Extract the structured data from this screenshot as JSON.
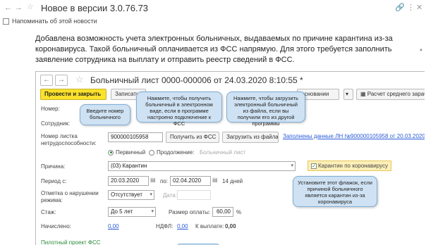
{
  "window": {
    "title": "Новое в версии 3.0.76.73",
    "controls": {
      "link": "🔗",
      "more": "⋮",
      "close": "✕"
    }
  },
  "remind": {
    "label": "Напоминать об этой новости",
    "checked": false
  },
  "intro": {
    "text": "Добавлена возможность учета электронных больничных, выдаваемых по причине карантина из-за коронавируса. Такой больничный оплачивается из ФСС напрямую. Для этого требуется заполнить заявление сотрудника на выплату и отправить реестр сведений в ФСС."
  },
  "form": {
    "title": "Больничный лист 0000-000006 от 24.03.2020 8:10:55 *",
    "toolbar": {
      "post_close": "Провести и закрыть",
      "write": "Записать",
      "basis": "основании",
      "calc": "Расчет среднего зараб"
    },
    "fields": {
      "number_label": "Номер:",
      "employee_label": "Сотрудник:",
      "sheet_label": "Номер листка нетрудоспособности:",
      "sheet_value": "900000105958",
      "get_fss": "Получить из ФСС",
      "load_file": "Загрузить из файла",
      "eln_link": "Заполнены данные ЛН №900000105958 от 20.03.2020",
      "primary": "Первичный",
      "continuation": "Продолжение:",
      "sick_list_link": "Больничный лист",
      "reason_label": "Причина:",
      "reason_value": "(03) Карантин",
      "quarantine_cb": "Карантин по коронавирусу",
      "period_label": "Период с:",
      "period_from": "20.03.2020",
      "period_to_label": "по:",
      "period_to": "02.04.2020",
      "days": "14 дней",
      "violation_label": "Отметка о нарушении режима:",
      "violation_value": "Отсутствует",
      "date_label": "Дата:",
      "experience_label": "Стаж:",
      "experience_value": "До 5 лет",
      "payment_label": "Размер оплаты:",
      "payment_value": "60,00",
      "percent": "%",
      "accrued_label": "Начислено:",
      "accrued_value": "0,00",
      "ndfl_label": "НДФЛ:",
      "ndfl_value": "0,00",
      "payout_label": "К выплате:",
      "payout_value": "0,00",
      "pilot": "Пилотный проект ФСС"
    }
  },
  "callouts": {
    "enter_number": "Введите номер больничного",
    "get_fss": "Нажмите, чтобы получить больничный в электронном виде, если в программе настроено подключение к ФСС",
    "load_file": "Нажмите, чтобы загрузить электронный больничный из файла, если вы получили его из другой программы",
    "flag": "Установите этот флажок, если причиной больничного является карантин из-за коронавируса"
  },
  "colors": {
    "accent": "#fbe22b",
    "callout": "#cfe2f3",
    "link": "#2a5bd7",
    "pilot": "#2a8a3a"
  }
}
